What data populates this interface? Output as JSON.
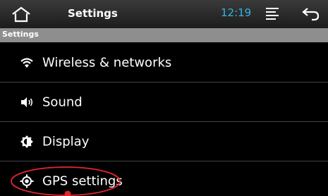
{
  "statusbar": {
    "title": "Settings",
    "time": "12:19",
    "time_color": "#33b5e5",
    "home_icon": "home-icon",
    "menu_icon": "menu-icon",
    "back_icon": "back-icon"
  },
  "section_header": "Settings",
  "items": [
    {
      "label": "Wireless & networks",
      "icon": "wifi-icon"
    },
    {
      "label": "Sound",
      "icon": "speaker-icon"
    },
    {
      "label": "Display",
      "icon": "brightness-icon"
    },
    {
      "label": "GPS settings",
      "icon": "gps-icon"
    }
  ],
  "annotation": {
    "color": "#e3262d"
  }
}
